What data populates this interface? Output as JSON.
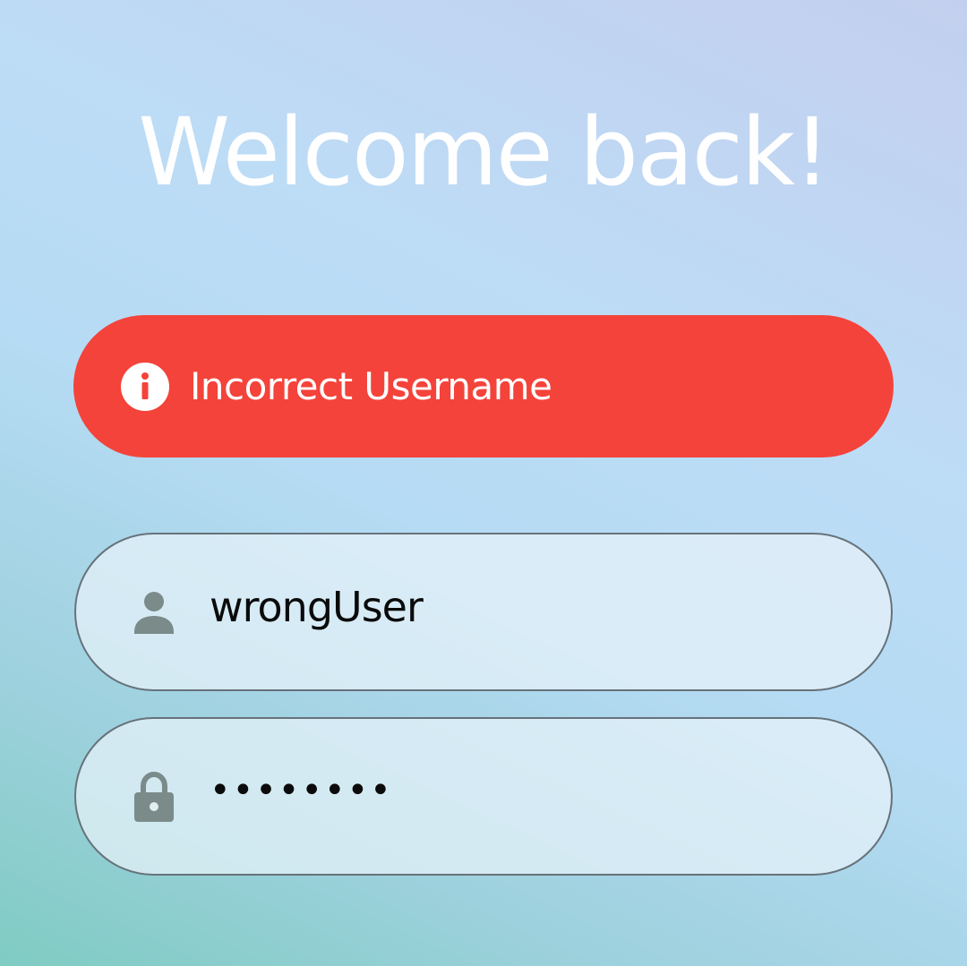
{
  "header": {
    "title": "Welcome back!"
  },
  "error": {
    "message": "Incorrect Username",
    "icon": "info-icon",
    "color": "#f4433a"
  },
  "username_field": {
    "value": "wrongUser",
    "icon": "person-icon"
  },
  "password_field": {
    "value": "••••••••",
    "icon": "lock-icon"
  },
  "colors": {
    "icon_gray": "#7a8b8a",
    "field_border": "#67727a"
  }
}
